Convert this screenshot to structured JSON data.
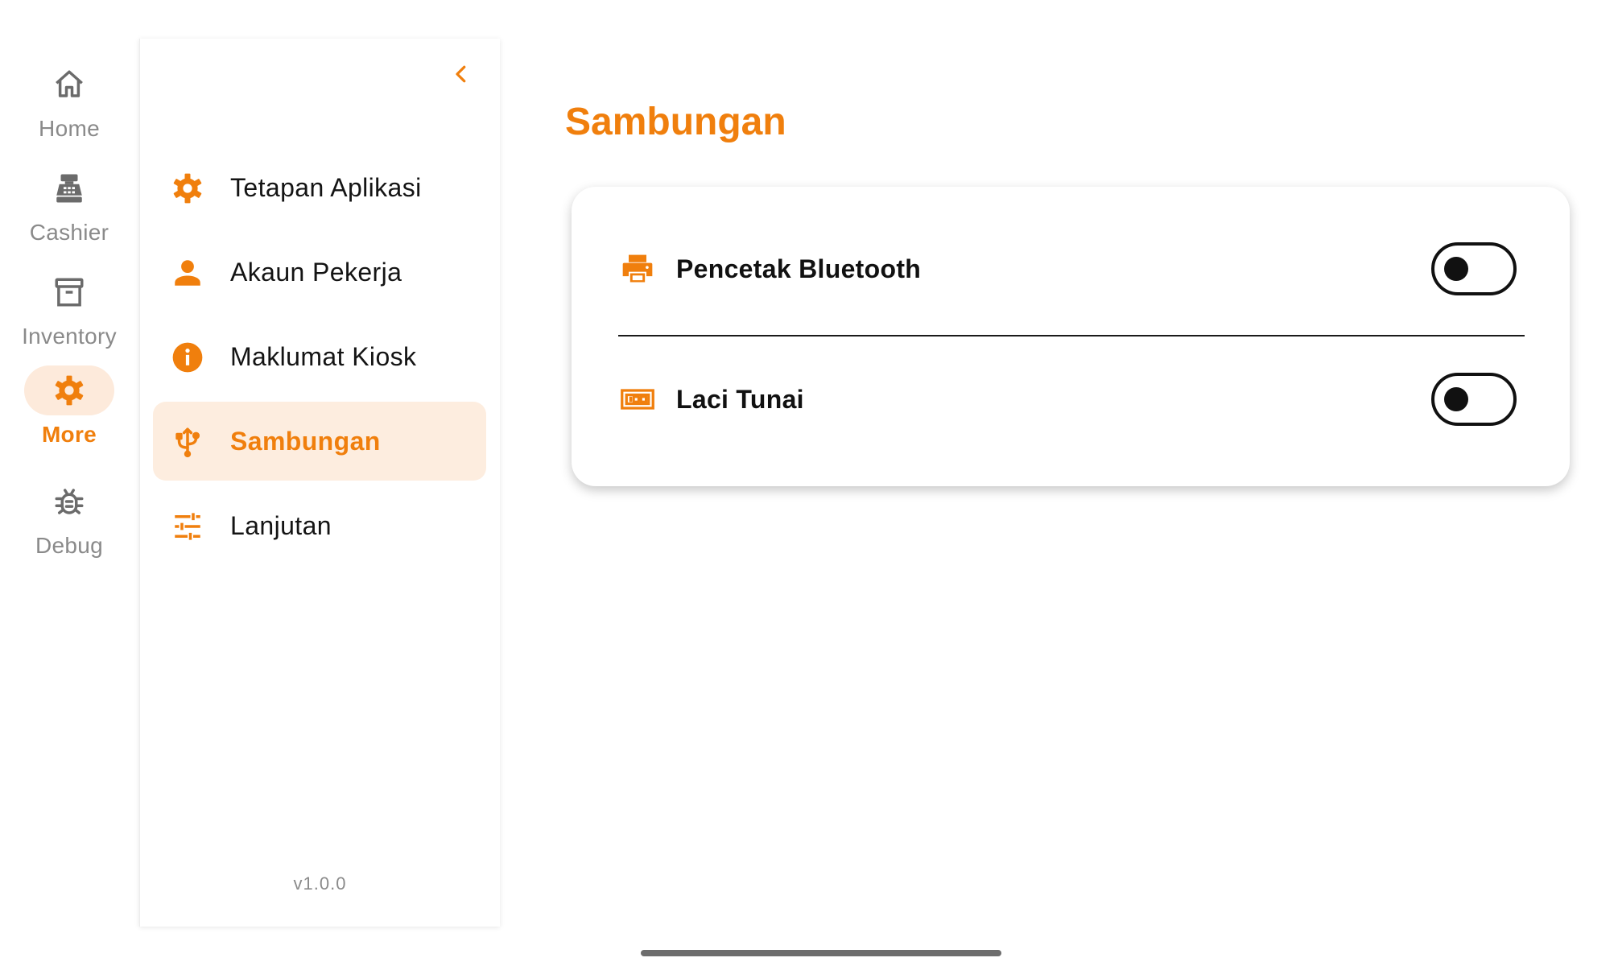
{
  "colors": {
    "accent": "#f07f0d",
    "accent_soft": "#fdeadb",
    "muted_text": "#8a8a8a",
    "text": "#111111"
  },
  "rail": {
    "items": [
      {
        "label": "Home",
        "icon": "home-icon",
        "active": false
      },
      {
        "label": "Cashier",
        "icon": "cash-register-icon",
        "active": false
      },
      {
        "label": "Inventory",
        "icon": "archive-box-icon",
        "active": false
      },
      {
        "label": "More",
        "icon": "gear-icon",
        "active": true
      },
      {
        "label": "Debug",
        "icon": "bug-icon",
        "active": false
      }
    ]
  },
  "drawer": {
    "collapse_icon": "chevron-left-icon",
    "items": [
      {
        "label": "Tetapan Aplikasi",
        "icon": "gear-icon",
        "active": false
      },
      {
        "label": "Akaun Pekerja",
        "icon": "person-icon",
        "active": false
      },
      {
        "label": "Maklumat Kiosk",
        "icon": "info-icon",
        "active": false
      },
      {
        "label": "Sambungan",
        "icon": "usb-icon",
        "active": true
      },
      {
        "label": "Lanjutan",
        "icon": "tune-sliders-icon",
        "active": false
      }
    ],
    "version": "v1.0.0"
  },
  "main": {
    "title": "Sambungan",
    "connections": [
      {
        "label": "Pencetak Bluetooth",
        "icon": "printer-icon",
        "enabled": false
      },
      {
        "label": "Laci Tunai",
        "icon": "cash-drawer-icon",
        "enabled": false
      }
    ]
  }
}
